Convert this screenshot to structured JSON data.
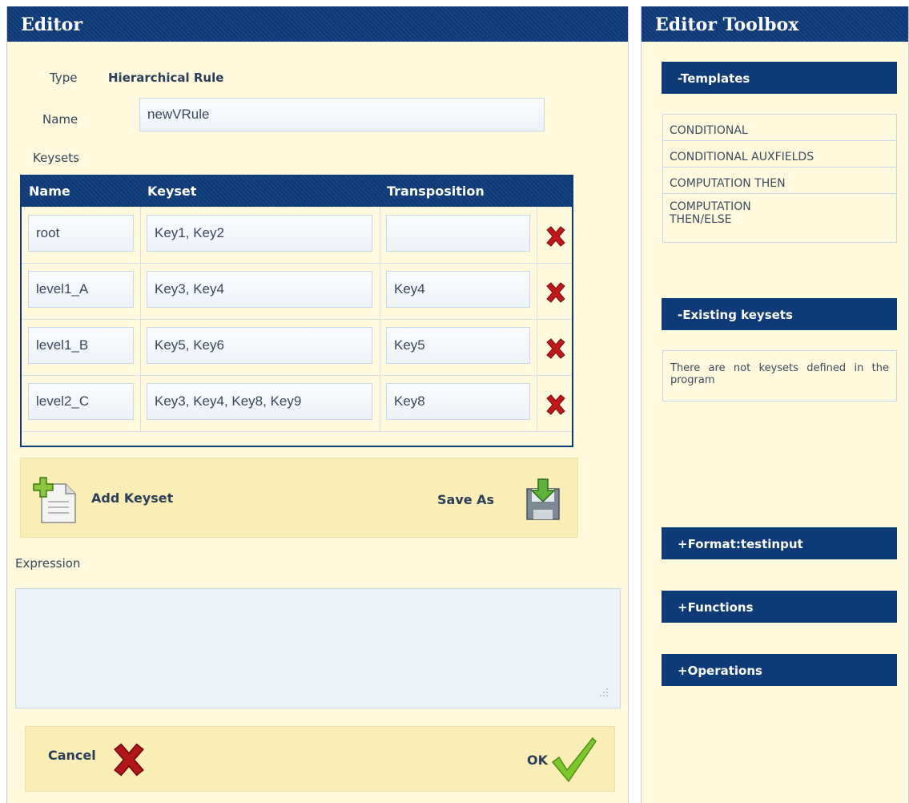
{
  "editor": {
    "title": "Editor",
    "type_label": "Type",
    "type_value": "Hierarchical Rule",
    "name_label": "Name",
    "name_value": "newVRule",
    "keysets_label": "Keysets",
    "table": {
      "columns": [
        "Name",
        "Keyset",
        "Transposition"
      ],
      "rows": [
        {
          "name": "root",
          "keyset": "Key1, Key2",
          "transposition": ""
        },
        {
          "name": "level1_A",
          "keyset": "Key3, Key4",
          "transposition": "Key4"
        },
        {
          "name": "level1_B",
          "keyset": "Key5, Key6",
          "transposition": "Key5"
        },
        {
          "name": "level2_C",
          "keyset": "Key3, Key4, Key8, Key9",
          "transposition": "Key8"
        }
      ]
    },
    "add_keyset_label": "Add Keyset",
    "save_as_label": "Save As",
    "expression_label": "Expression",
    "expression_value": "",
    "cancel_label": "Cancel",
    "ok_label": "OK"
  },
  "toolbox": {
    "title": "Editor Toolbox",
    "templates_header": "-Templates",
    "templates": [
      "CONDITIONAL",
      "CONDITIONAL AUXFIELDS",
      "COMPUTATION THEN",
      "COMPUTATION THEN/ELSE"
    ],
    "existing_keysets_header": "-Existing keysets",
    "existing_keysets_note": "There are not keysets defined in the program",
    "format_header": "+Format:testinput",
    "functions_header": "+Functions",
    "operations_header": "+Operations"
  },
  "colors": {
    "header_blue": "#0f3a78",
    "panel_bg": "#fff9dd",
    "action_bar_bg": "#faedb5",
    "delete_red": "#c0171a",
    "ok_green": "#6fbf1d"
  }
}
